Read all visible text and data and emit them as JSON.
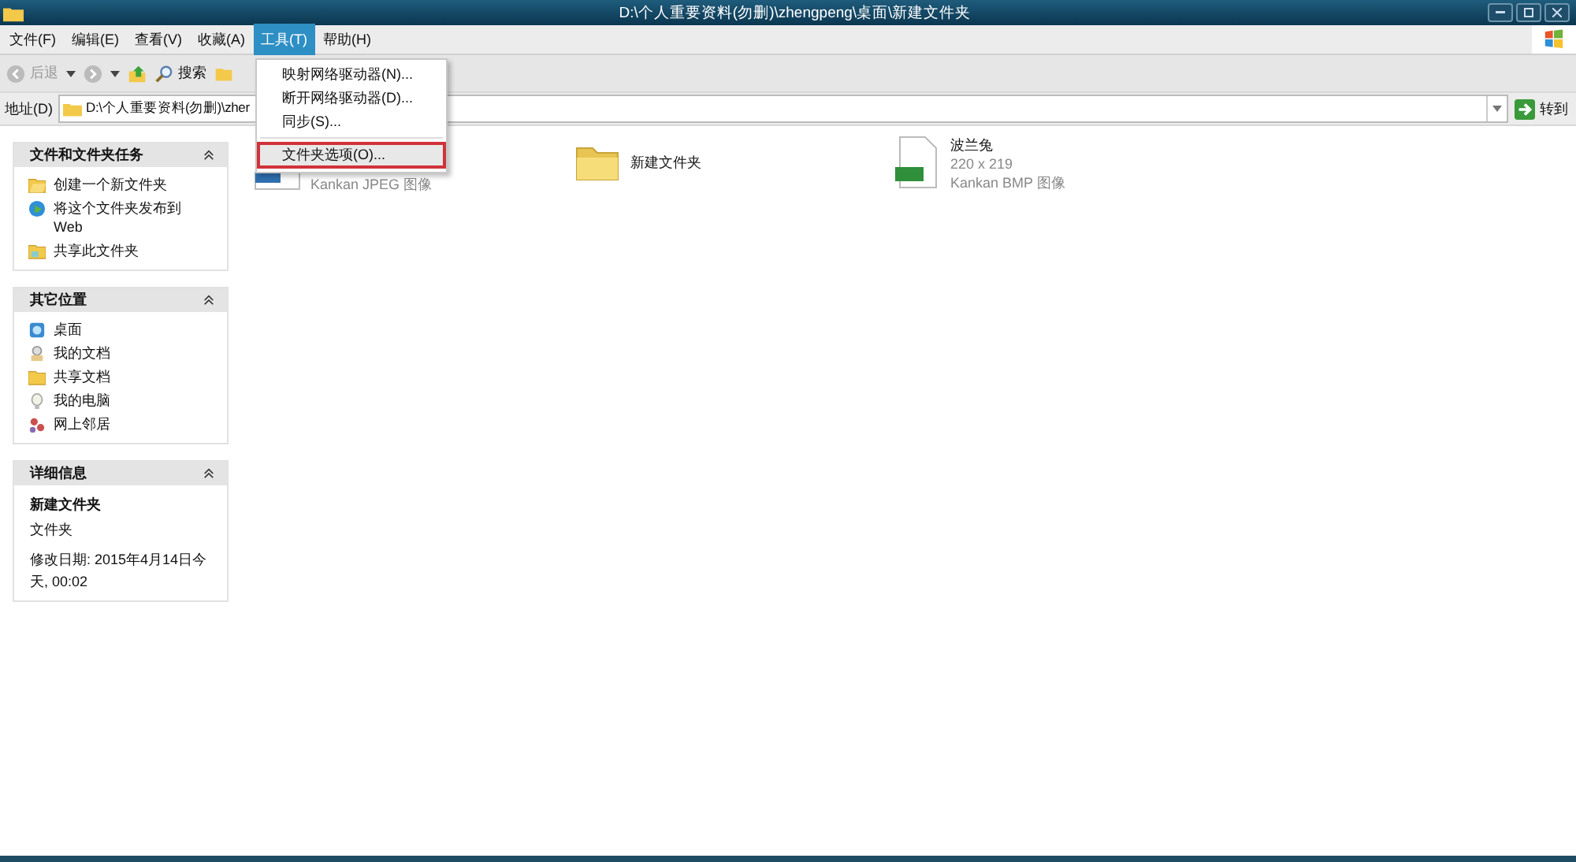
{
  "window": {
    "title": "D:\\个人重要资料(勿删)\\zhengpeng\\桌面\\新建文件夹"
  },
  "menu_bar": [
    {
      "label": "文件(F)",
      "selected": false
    },
    {
      "label": "编辑(E)",
      "selected": false
    },
    {
      "label": "查看(V)",
      "selected": false
    },
    {
      "label": "收藏(A)",
      "selected": false
    },
    {
      "label": "工具(T)",
      "selected": true
    },
    {
      "label": "帮助(H)",
      "selected": false
    }
  ],
  "toolbar": {
    "back": "后退",
    "search": "搜索"
  },
  "address_bar": {
    "label": "地址(D)",
    "value": "D:\\个人重要资料(勿删)\\zher",
    "go": "转到"
  },
  "dropdown_menu": [
    {
      "label": "映射网络驱动器(N)...",
      "highlighted": false
    },
    {
      "label": "断开网络驱动器(D)...",
      "highlighted": false
    },
    {
      "label": "同步(S)...",
      "highlighted": false
    },
    {
      "label": "文件夹选项(O)...",
      "highlighted": true,
      "separator_before": true
    }
  ],
  "sidebar": [
    {
      "title": "文件和文件夹任务",
      "kind": "links",
      "items": [
        {
          "label": "创建一个新文件夹",
          "kind": "newfolder"
        },
        {
          "label": "将这个文件夹发布到 Web",
          "kind": "globe"
        },
        {
          "label": "共享此文件夹",
          "kind": "sharefolder"
        }
      ]
    },
    {
      "title": "其它位置",
      "kind": "links",
      "items": [
        {
          "label": "桌面",
          "kind": "desktop"
        },
        {
          "label": "我的文档",
          "kind": "documents"
        },
        {
          "label": "共享文档",
          "kind": "folder"
        },
        {
          "label": "我的电脑",
          "kind": "computer"
        },
        {
          "label": "网上邻居",
          "kind": "network"
        }
      ]
    },
    {
      "title": "详细信息",
      "kind": "details",
      "name": "新建文件夹",
      "type": "文件夹",
      "modified": "修改日期: 2015年4月14日今天, 00:02"
    }
  ],
  "files": [
    {
      "kind": "jpeg",
      "lines": [
        "Kankan JPEG 图像"
      ]
    },
    {
      "kind": "folder",
      "name": "新建文件夹"
    },
    {
      "kind": "bmp",
      "name": "波兰兔",
      "lines": [
        "220 x 219",
        "Kankan BMP 图像"
      ]
    }
  ]
}
